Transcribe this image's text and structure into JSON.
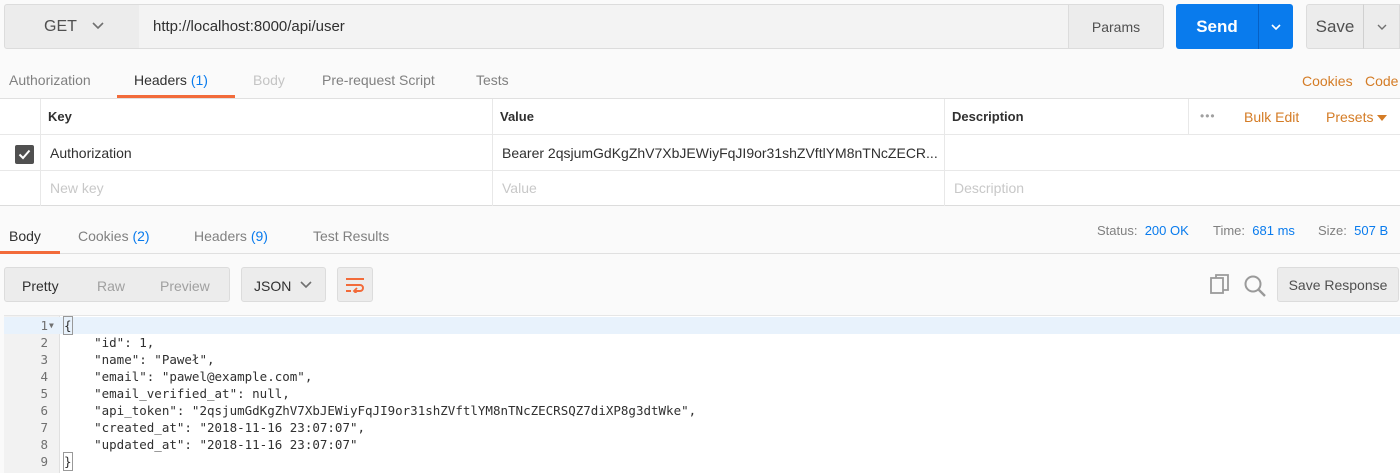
{
  "request": {
    "method": "GET",
    "url": "http://localhost:8000/api/user",
    "params_label": "Params",
    "send_label": "Send",
    "save_label": "Save"
  },
  "request_tabs": [
    {
      "label": "Authorization",
      "count": ""
    },
    {
      "label": "Headers",
      "count": "(1)"
    },
    {
      "label": "Body",
      "count": ""
    },
    {
      "label": "Pre-request Script",
      "count": ""
    },
    {
      "label": "Tests",
      "count": ""
    }
  ],
  "request_links": {
    "cookies": "Cookies",
    "code": "Code"
  },
  "headers_table": {
    "columns": {
      "key": "Key",
      "value": "Value",
      "description": "Description"
    },
    "actions": {
      "more": "•••",
      "bulk_edit": "Bulk Edit",
      "presets": "Presets"
    },
    "rows": [
      {
        "key": "Authorization",
        "value": "Bearer 2qsjumGdKgZhV7XbJEWiyFqJI9or31shZVftlYM8nTNcZECR...",
        "description": "",
        "checked": true
      }
    ],
    "placeholders": {
      "key": "New key",
      "value": "Value",
      "description": "Description"
    }
  },
  "response_tabs": [
    {
      "label": "Body",
      "count": ""
    },
    {
      "label": "Cookies",
      "count": "(2)"
    },
    {
      "label": "Headers",
      "count": "(9)"
    },
    {
      "label": "Test Results",
      "count": ""
    }
  ],
  "response_status": {
    "status_label": "Status:",
    "status": "200 OK",
    "time_label": "Time:",
    "time": "681 ms",
    "size_label": "Size:",
    "size": "507 B"
  },
  "view_modes": [
    "Pretty",
    "Raw",
    "Preview"
  ],
  "format": "JSON",
  "save_response_label": "Save Response",
  "code_lines": [
    {
      "num": "1",
      "text": "{"
    },
    {
      "num": "2",
      "text": "    \"id\": 1,"
    },
    {
      "num": "3",
      "text": "    \"name\": \"Paweł\","
    },
    {
      "num": "4",
      "text": "    \"email\": \"pawel@example.com\","
    },
    {
      "num": "5",
      "text": "    \"email_verified_at\": null,"
    },
    {
      "num": "6",
      "text": "    \"api_token\": \"2qsjumGdKgZhV7XbJEWiyFqJI9or31shZVftlYM8nTNcZECRSQZ7diXP8g3dtWke\","
    },
    {
      "num": "7",
      "text": "    \"created_at\": \"2018-11-16 23:07:07\","
    },
    {
      "num": "8",
      "text": "    \"updated_at\": \"2018-11-16 23:07:07\""
    },
    {
      "num": "9",
      "text": "}"
    }
  ],
  "colors": {
    "accent": "#097bed",
    "tab_underline": "#f26b3a",
    "link_orange": "#d47c26"
  }
}
